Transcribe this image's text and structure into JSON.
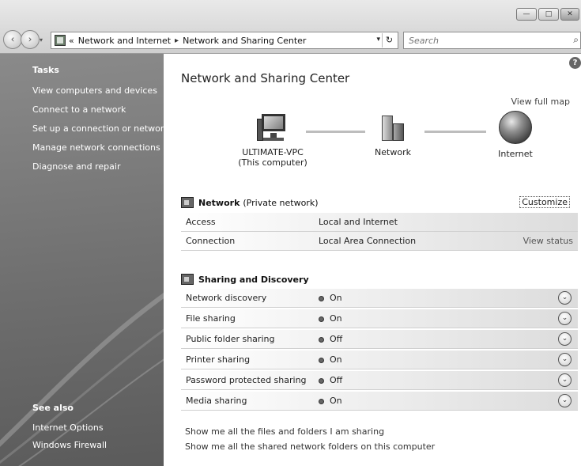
{
  "window": {
    "minimize_glyph": "—",
    "maximize_glyph": "□",
    "close_glyph": "✕"
  },
  "address_bar": {
    "prefix": "«",
    "segments": [
      "Network and Internet",
      "Network and Sharing Center"
    ],
    "separator": "▸",
    "dropdown_glyph": "▾",
    "refresh_glyph": "↻",
    "back_glyph": "‹",
    "forward_glyph": "›",
    "recent_glyph": "▾"
  },
  "search": {
    "placeholder": "Search",
    "icon": "search-icon"
  },
  "sidebar": {
    "tasks_title": "Tasks",
    "tasks": [
      "View computers and devices",
      "Connect to a network",
      "Set up a connection or network",
      "Manage network connections",
      "Diagnose and repair"
    ],
    "see_also_title": "See also",
    "see_also": [
      "Internet Options",
      "Windows Firewall"
    ]
  },
  "main": {
    "help_glyph": "?",
    "title": "Network and Sharing Center",
    "view_full_map": "View full map",
    "map": {
      "computer_name": "ULTIMATE-VPC",
      "computer_sub": "(This computer)",
      "network_label": "Network",
      "internet_label": "Internet"
    },
    "network_section": {
      "name": "Network",
      "type": "(Private network)",
      "customize": "Customize",
      "rows": [
        {
          "label": "Access",
          "value": "Local and Internet",
          "action": ""
        },
        {
          "label": "Connection",
          "value": "Local Area Connection",
          "action": "View status"
        }
      ]
    },
    "sharing_section": {
      "title": "Sharing and Discovery",
      "expand_glyph": "⌄",
      "rows": [
        {
          "label": "Network discovery",
          "value": "On"
        },
        {
          "label": "File sharing",
          "value": "On"
        },
        {
          "label": "Public folder sharing",
          "value": "Off"
        },
        {
          "label": "Printer sharing",
          "value": "On"
        },
        {
          "label": "Password protected sharing",
          "value": "Off"
        },
        {
          "label": "Media sharing",
          "value": "On"
        }
      ]
    },
    "bottom_links": [
      "Show me all the files and folders I am sharing",
      "Show me all the shared network folders on this computer"
    ]
  }
}
